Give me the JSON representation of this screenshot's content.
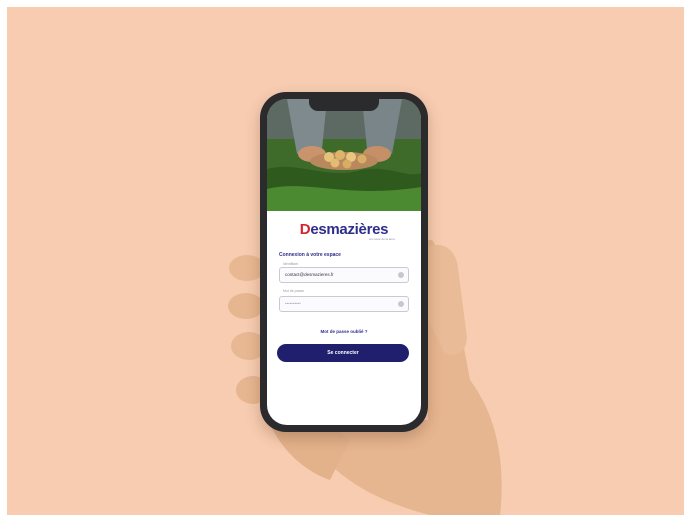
{
  "app": {
    "brand_first_letter": "D",
    "brand_rest": "esmazières",
    "tagline": "Au cœur de la terre",
    "login_title": "Connexion à votre espace",
    "username_label": "Identifiant",
    "username_value": "contact@desmazieres.fr",
    "password_label": "Mot de passe",
    "password_placeholder": "••••••••••",
    "forgot_link": "Mot de passe oublié ?",
    "login_button": "Se connecter"
  },
  "colors": {
    "background": "#f7ccb0",
    "brand_red": "#d4242e",
    "brand_navy": "#2e2e8c",
    "button": "#1f1f6e"
  },
  "icons": [
    "eye-icon",
    "chevron-icon"
  ]
}
